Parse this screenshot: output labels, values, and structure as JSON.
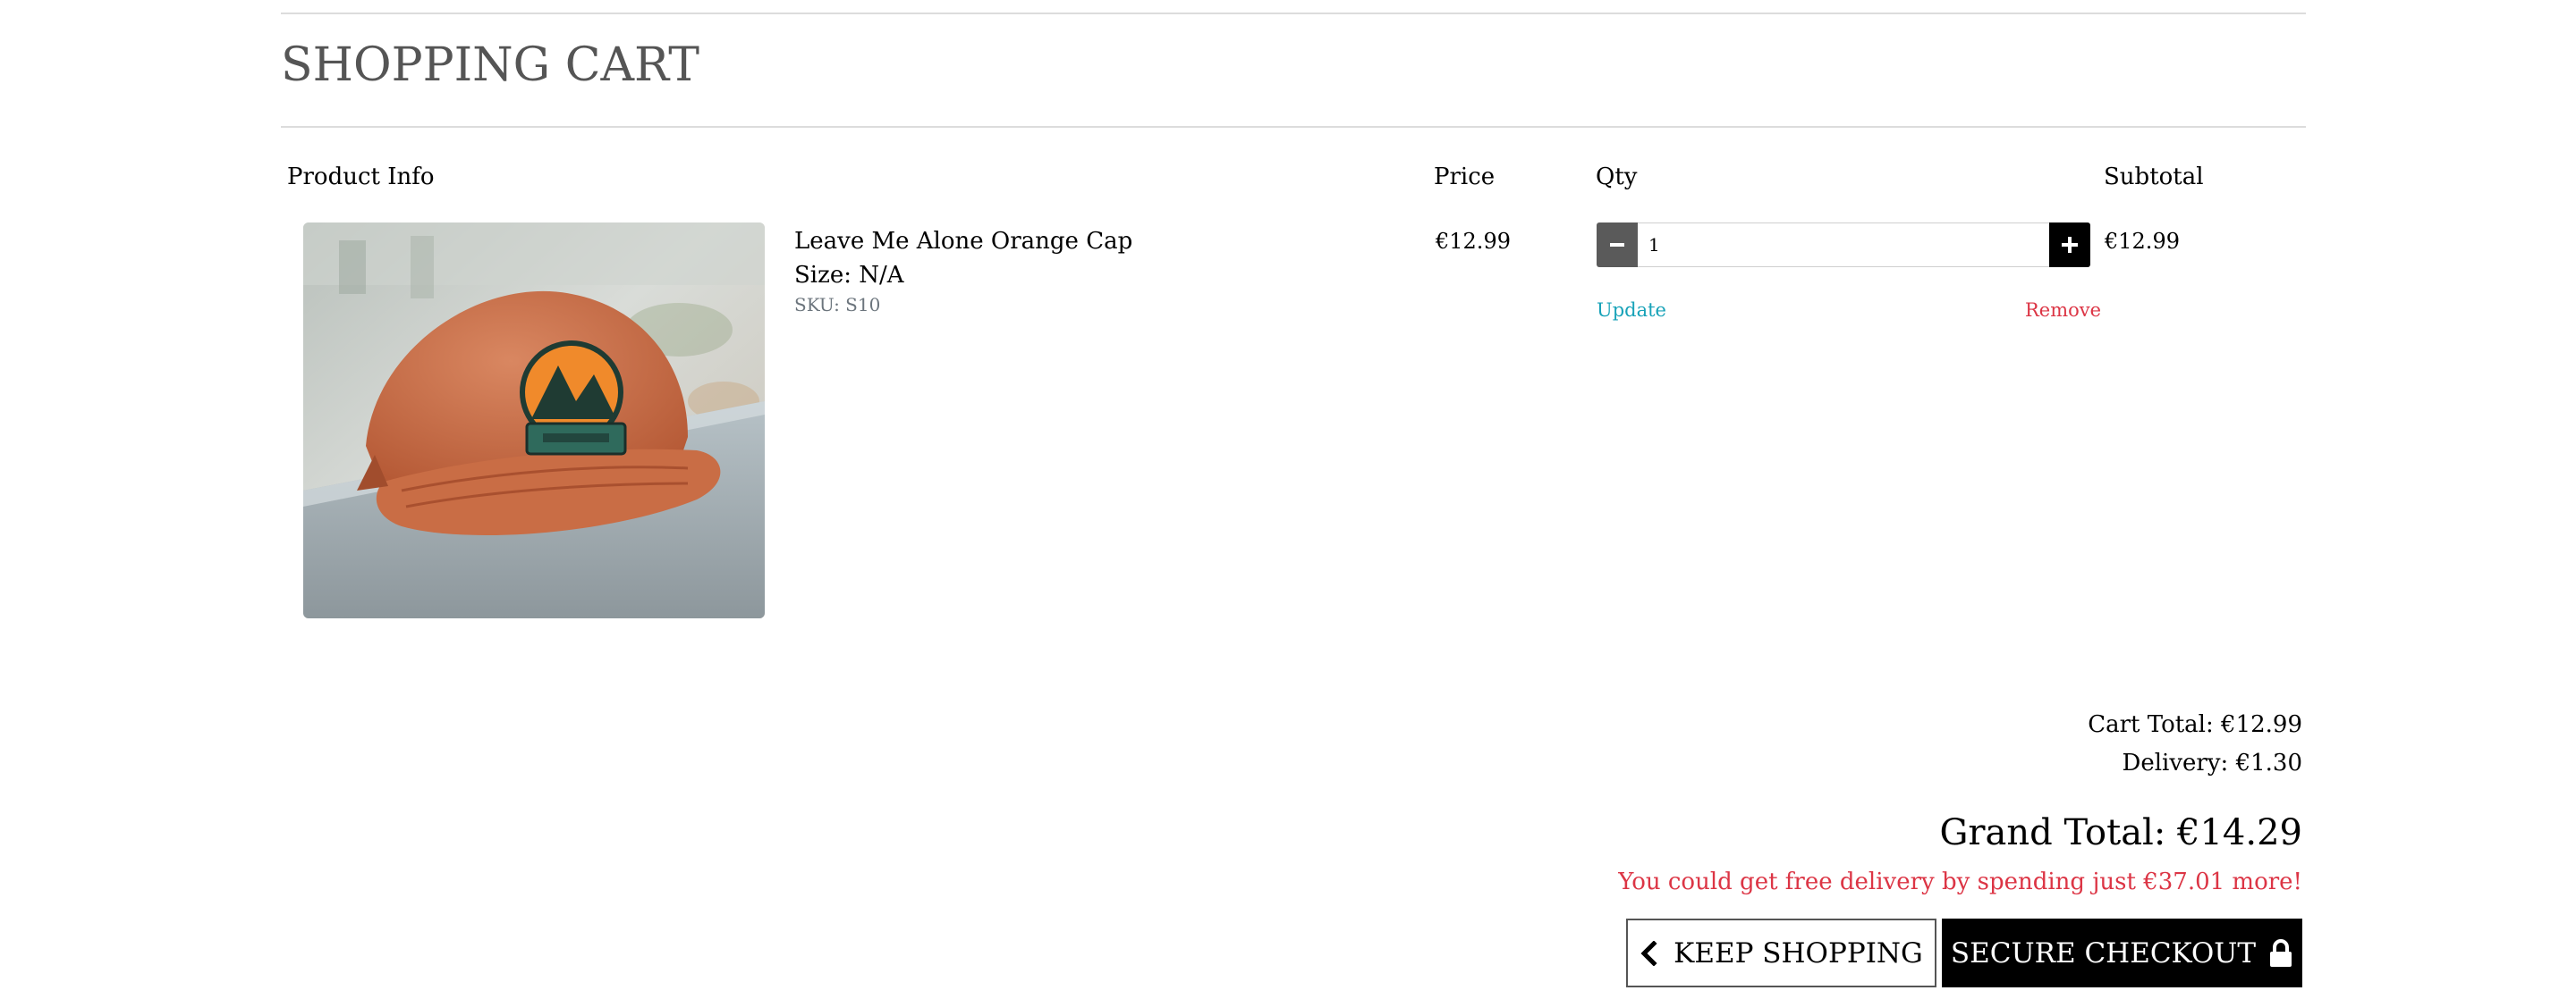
{
  "header": {
    "title": "SHOPPING CART"
  },
  "table": {
    "columns": {
      "product": "Product Info",
      "price": "Price",
      "qty": "Qty",
      "subtotal": "Subtotal"
    },
    "items": [
      {
        "name": "Leave Me Alone Orange Cap",
        "size": "Size: N/A",
        "sku": "SKU: S10",
        "price": "€12.99",
        "quantity": "1",
        "update_label": "Update",
        "remove_label": "Remove",
        "subtotal": "€12.99",
        "image_icon": "orange-cap-photo"
      }
    ]
  },
  "summary": {
    "cart_total": "Cart Total: €12.99",
    "delivery": "Delivery: €1.30",
    "grand_total": "Grand Total: €14.29",
    "free_delivery_notice": "You could get free delivery by spending just €37.01 more!"
  },
  "actions": {
    "keep_shopping_label": "KEEP SHOPPING",
    "keep_shopping_icon": "chevron-left-icon",
    "checkout_label": "SECURE CHECKOUT",
    "checkout_icon": "lock-icon"
  },
  "colors": {
    "update_link": "#17a2b8",
    "remove_link": "#dc3545",
    "notice": "#dc3545",
    "checkout_bg": "#000000"
  }
}
